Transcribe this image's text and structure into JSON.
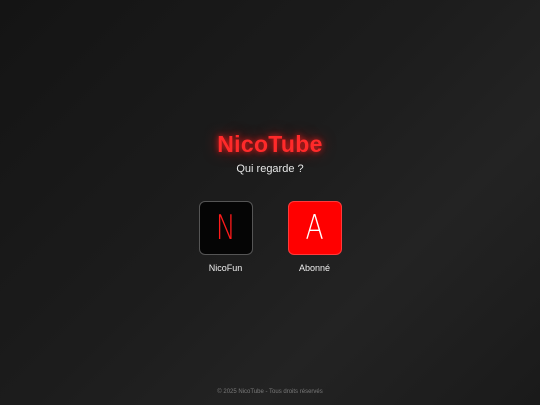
{
  "app": {
    "brand": "NicoTube",
    "prompt": "Qui regarde ?"
  },
  "profiles": [
    {
      "initial": "N",
      "name": "NicoFun",
      "style": "dark",
      "letter_color": "#ff1a1a",
      "tile_color": "#050505"
    },
    {
      "initial": "A",
      "name": "Abonné",
      "style": "red",
      "letter_color": "#ffffff",
      "tile_color": "#ff0000"
    }
  ],
  "footer": {
    "text": "© 2025 NicoTube - Tous droits réservés"
  },
  "colors": {
    "accent": "#ff2a2a",
    "background": "#1a1a1a"
  }
}
